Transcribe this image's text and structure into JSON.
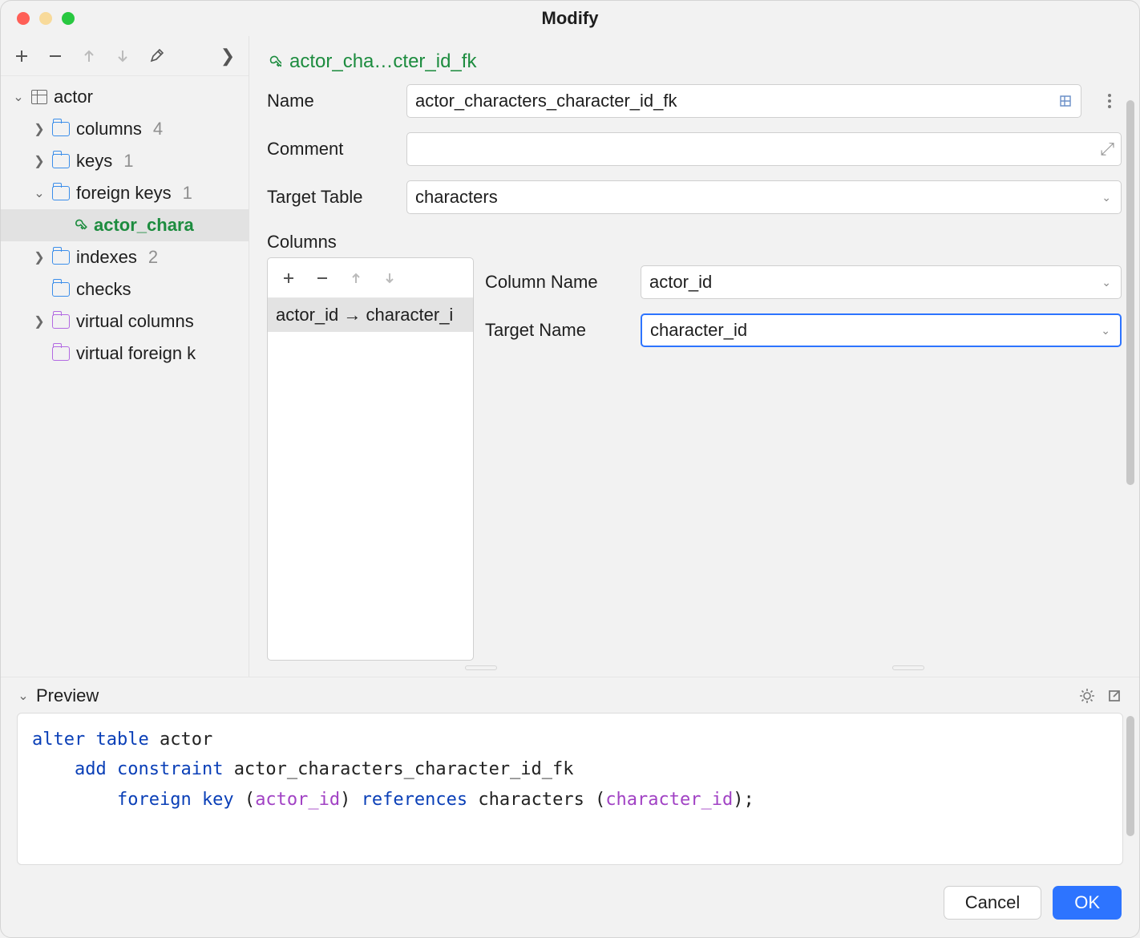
{
  "window": {
    "title": "Modify"
  },
  "tree": {
    "root": {
      "label": "actor"
    },
    "columns": {
      "label": "columns",
      "count": "4"
    },
    "keys": {
      "label": "keys",
      "count": "1"
    },
    "foreign_keys": {
      "label": "foreign keys",
      "count": "1"
    },
    "fk_selected": {
      "label": "actor_chara"
    },
    "indexes": {
      "label": "indexes",
      "count": "2"
    },
    "checks": {
      "label": "checks"
    },
    "virtual_columns": {
      "label": "virtual columns"
    },
    "virtual_fks": {
      "label": "virtual foreign k"
    }
  },
  "detail": {
    "header_name": "actor_cha…cter_id_fk",
    "name_label": "Name",
    "name_value": "actor_characters_character_id_fk",
    "comment_label": "Comment",
    "comment_value": "",
    "target_table_label": "Target Table",
    "target_table_value": "characters",
    "columns_label": "Columns",
    "columns_list": {
      "row0": "actor_id → character_i"
    },
    "column_name_label": "Column Name",
    "column_name_value": "actor_id",
    "target_name_label": "Target Name",
    "target_name_value": "character_id"
  },
  "preview": {
    "label": "Preview",
    "sql": {
      "kw_alter": "alter",
      "kw_table": "table",
      "tbl": "actor",
      "kw_add": "add",
      "kw_constraint": "constraint",
      "constraint_name": "actor_characters_character_id_fk",
      "kw_foreign": "foreign",
      "kw_key": "key",
      "col_local": "actor_id",
      "kw_references": "references",
      "ref_table": "characters",
      "col_target": "character_id"
    }
  },
  "footer": {
    "cancel": "Cancel",
    "ok": "OK"
  }
}
